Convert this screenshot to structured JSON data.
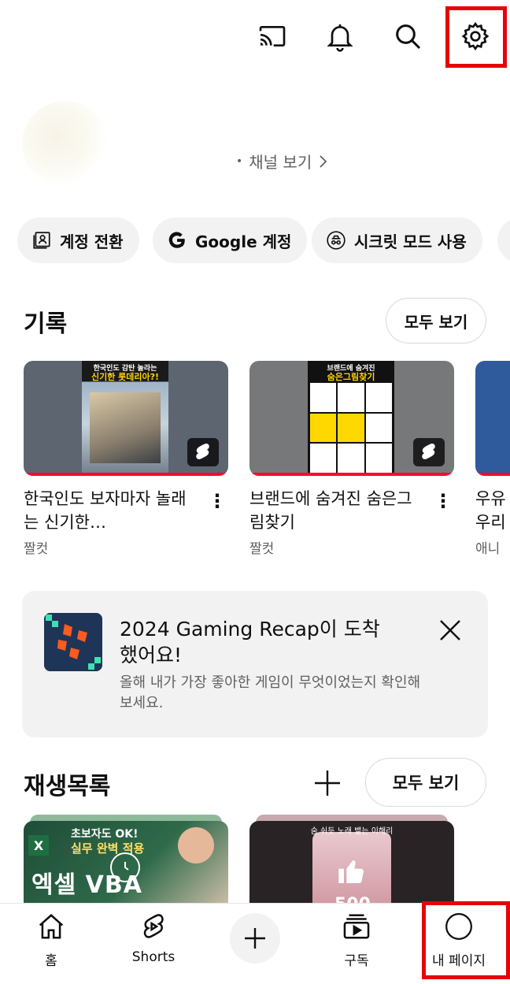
{
  "top_bar": {
    "icons": [
      "cast-icon",
      "notifications-icon",
      "search-icon",
      "settings-icon"
    ]
  },
  "profile": {
    "channel_link": "채널 보기",
    "dot": "•"
  },
  "chips": [
    {
      "label": "계정 전환",
      "icon": "switch-account-icon"
    },
    {
      "label": "Google 계정",
      "icon": "google-icon"
    },
    {
      "label": "시크릿 모드 사용",
      "icon": "incognito-icon"
    }
  ],
  "history": {
    "title": "기록",
    "see_all": "모두 보기",
    "items": [
      {
        "title": "한국인도 보자마자 놀래는 신기한…",
        "channel": "짤컷",
        "thumb_caption_top": "한국인도 감탄 놀라는",
        "thumb_caption": "신기한 롯데리아?!"
      },
      {
        "title": "브랜드에 숨겨진 숨은그림찾기",
        "channel": "짤컷",
        "thumb_caption_top": "브랜드에 숨겨진",
        "thumb_caption": "숨은그림찾기"
      },
      {
        "title": "우유 우리",
        "channel": "애니"
      }
    ]
  },
  "recap": {
    "title": "2024 Gaming Recap이 도착했어요!",
    "subtitle": "올해 내가 가장 좋아한 게임이 무엇이었는지 확인해 보세요."
  },
  "playlists": {
    "title": "재생목록",
    "see_all": "모두 보기",
    "items": [
      {
        "thumb_line1": "초보자도 OK!",
        "thumb_line2": "실무 완벽 적용",
        "thumb_line3": "엑셀 VBA"
      },
      {
        "thumb_line1": "숨 쉬듯 노래 뱉는 이해리",
        "count": "500"
      }
    ]
  },
  "bottom_nav": {
    "home": "홈",
    "shorts": "Shorts",
    "subscriptions": "구독",
    "you": "내 페이지"
  },
  "colors": {
    "highlight": "#e8000b",
    "progress": "#ff0033",
    "chip_bg": "#f2f2f2",
    "secondary_text": "#606060"
  }
}
